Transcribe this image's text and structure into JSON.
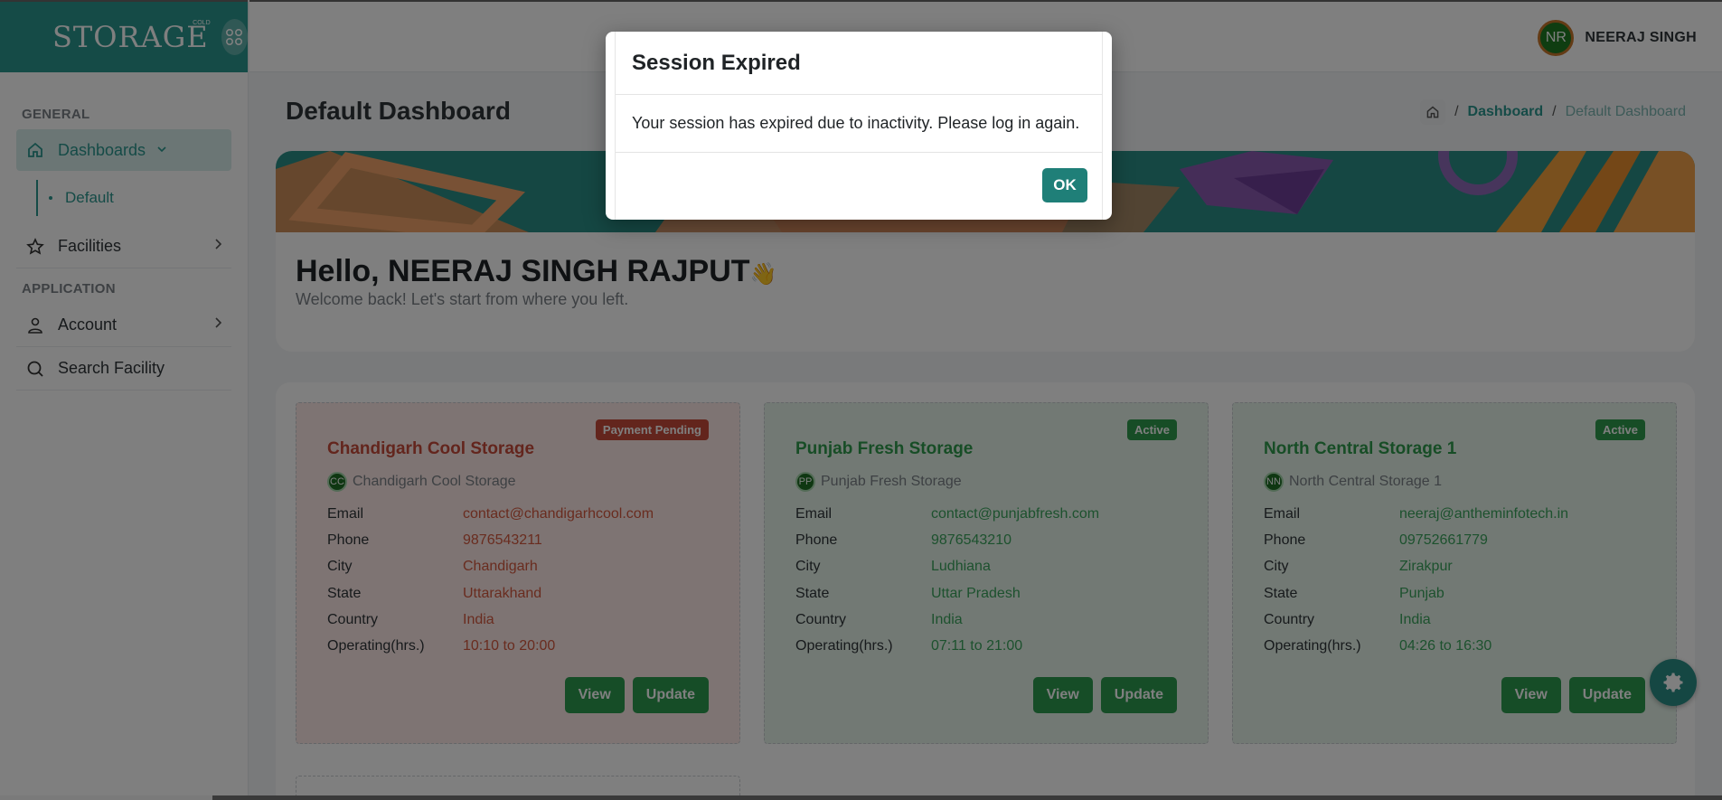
{
  "sidebar": {
    "logo_text": "STORAGE",
    "logo_small": "COLD",
    "section_general": "GENERAL",
    "section_application": "APPLICATION",
    "items": {
      "dashboards": "Dashboards",
      "default": "Default",
      "facilities": "Facilities",
      "account": "Account",
      "search": "Search Facility"
    }
  },
  "header": {
    "user_initials": "NR",
    "user_name": "NEERAJ SINGH"
  },
  "page": {
    "title": "Default Dashboard",
    "breadcrumb": [
      "Dashboard",
      "Default Dashboard"
    ]
  },
  "welcome": {
    "greeting": "Hello, NEERAJ SINGH RAJPUT",
    "wave": "👋",
    "subtitle": "Welcome back! Let's start from where you left."
  },
  "facilities": {
    "labels": {
      "email": "Email",
      "phone": "Phone",
      "city": "City",
      "state": "State",
      "country": "Country",
      "hours": "Operating(hrs.)",
      "view": "View",
      "update": "Update"
    },
    "cards": [
      {
        "status": "Payment Pending",
        "name": "Chandigarh Cool Storage",
        "initials": "CC",
        "subname": "Chandigarh Cool Storage",
        "email": "contact@chandigarhcool.com",
        "phone": "9876543211",
        "city": "Chandigarh",
        "state": "Uttarakhand",
        "country": "India",
        "hours": "10:10 to 20:00"
      },
      {
        "status": "Active",
        "name": "Punjab Fresh Storage",
        "initials": "PP",
        "subname": "Punjab Fresh Storage",
        "email": "contact@punjabfresh.com",
        "phone": "9876543210",
        "city": "Ludhiana",
        "state": "Uttar Pradesh",
        "country": "India",
        "hours": "07:11 to 21:00"
      },
      {
        "status": "Active",
        "name": "North Central Storage 1",
        "initials": "NN",
        "subname": "North Central Storage 1",
        "email": "neeraj@antheminfotech.in",
        "phone": "09752661779",
        "city": "Zirakpur",
        "state": "Punjab",
        "country": "India",
        "hours": "04:26 to 16:30"
      }
    ]
  },
  "modal": {
    "title": "Session Expired",
    "message": "Your session has expired due to inactivity. Please log in again.",
    "ok_label": "OK"
  },
  "colors": {
    "brand": "#2b968e",
    "pending": "#c74b3a",
    "active": "#2f9a4c"
  }
}
